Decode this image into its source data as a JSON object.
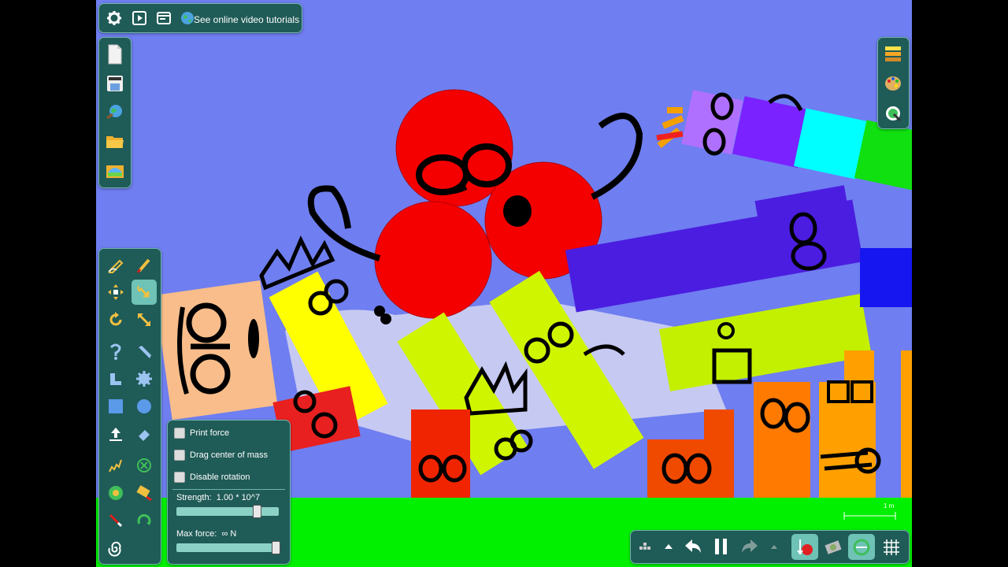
{
  "top_toolbar": {
    "tutorials_label": "See online video tutorials",
    "icons": [
      "gear-icon",
      "play-icon",
      "window-icon",
      "globe-icon"
    ]
  },
  "file_toolbar": {
    "icons": [
      "new-file-icon",
      "save-icon",
      "browse-online-icon",
      "open-folder-icon",
      "scene-icon"
    ]
  },
  "right_toolbar": {
    "icons": [
      "layers-icon",
      "palette-icon",
      "zoom-icon"
    ]
  },
  "tools": {
    "icons": [
      "sketch-icon",
      "brush-icon",
      "move-icon",
      "grab-icon",
      "rotate-icon",
      "scale-icon",
      "hinge-icon",
      "knife-icon",
      "plane-icon",
      "gear-shape-icon",
      "box-icon",
      "circle-icon",
      "fixate-icon",
      "eraser-icon",
      "spring-icon",
      "delete-icon",
      "axle-icon",
      "tracer-icon",
      "laser-icon",
      "chain-icon",
      "spiral-icon"
    ],
    "active": "grab-icon"
  },
  "grab_options": {
    "checkboxes": [
      {
        "label": "Print force",
        "checked": false
      },
      {
        "label": "Drag center of mass",
        "checked": false
      },
      {
        "label": "Disable rotation",
        "checked": false
      }
    ],
    "strength_label": "Strength:",
    "strength_value": "1.00 * 10^7",
    "strength_fraction": 0.8,
    "maxforce_label": "Max force:",
    "maxforce_value": "∞  N",
    "maxforce_fraction": 1.0
  },
  "scale_label": "1 m",
  "bottom_toolbar": {
    "icons": [
      "grid-menu-icon",
      "up-arrow-icon",
      "undo-icon",
      "pause-icon",
      "redo-icon",
      "up-arrow-small-icon",
      "gravity-icon",
      "air-friction-icon",
      "collision-icon",
      "grid-icon"
    ]
  },
  "colors": {
    "sky": "#6f7ef0",
    "ground": "#00f000",
    "toolbar_bg": "#1f5b57",
    "active_tool": "#6ec2b6"
  }
}
